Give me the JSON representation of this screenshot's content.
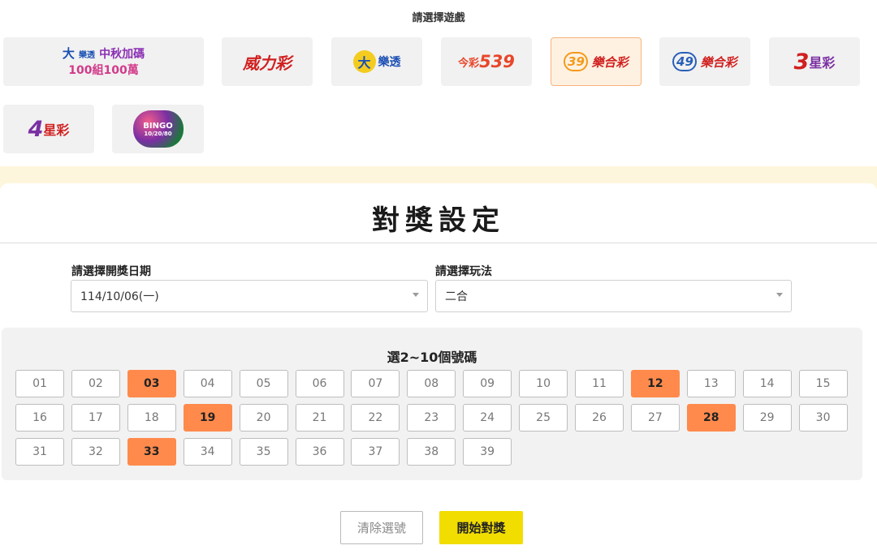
{
  "header": {
    "title": "請選擇遊戲"
  },
  "games": [
    {
      "name": "大樂透 中秋加碼 100組100萬",
      "line1": "中秋加碼",
      "line2": "100組100萬",
      "mark": "大",
      "sub": "樂透"
    },
    {
      "name": "威力彩",
      "label": "威力彩"
    },
    {
      "name": "大樂透",
      "mark": "大",
      "label": "樂透"
    },
    {
      "name": "今彩539",
      "label": "今彩",
      "num": "539"
    },
    {
      "name": "39樂合彩",
      "num": "39",
      "label": "樂合彩"
    },
    {
      "name": "49樂合彩",
      "num": "49",
      "label": "樂合彩"
    },
    {
      "name": "3星彩",
      "num": "3",
      "label": "星彩"
    },
    {
      "name": "4星彩",
      "num": "4",
      "label": "星彩"
    },
    {
      "name": "BINGO BINGO 賓果賓果",
      "label": "BINGO",
      "sub": "10/20/80"
    }
  ],
  "selected_game_index": 4,
  "settings": {
    "title": "對獎設定",
    "date_label": "請選擇開獎日期",
    "date_value": "114/10/06(一)",
    "play_label": "請選擇玩法",
    "play_value": "二合"
  },
  "numbers": {
    "title": "選2~10個號碼",
    "items": [
      "01",
      "02",
      "03",
      "04",
      "05",
      "06",
      "07",
      "08",
      "09",
      "10",
      "11",
      "12",
      "13",
      "14",
      "15",
      "16",
      "17",
      "18",
      "19",
      "20",
      "21",
      "22",
      "23",
      "24",
      "25",
      "26",
      "27",
      "28",
      "29",
      "30",
      "31",
      "32",
      "33",
      "34",
      "35",
      "36",
      "37",
      "38",
      "39"
    ],
    "selected": [
      "03",
      "12",
      "19",
      "28",
      "33"
    ]
  },
  "actions": {
    "clear_label": "清除選號",
    "start_label": "開始對獎"
  },
  "colors": {
    "selected_number": "#ff8a4c",
    "start_button": "#f1dd00",
    "header_band": "#fdf6dc"
  }
}
